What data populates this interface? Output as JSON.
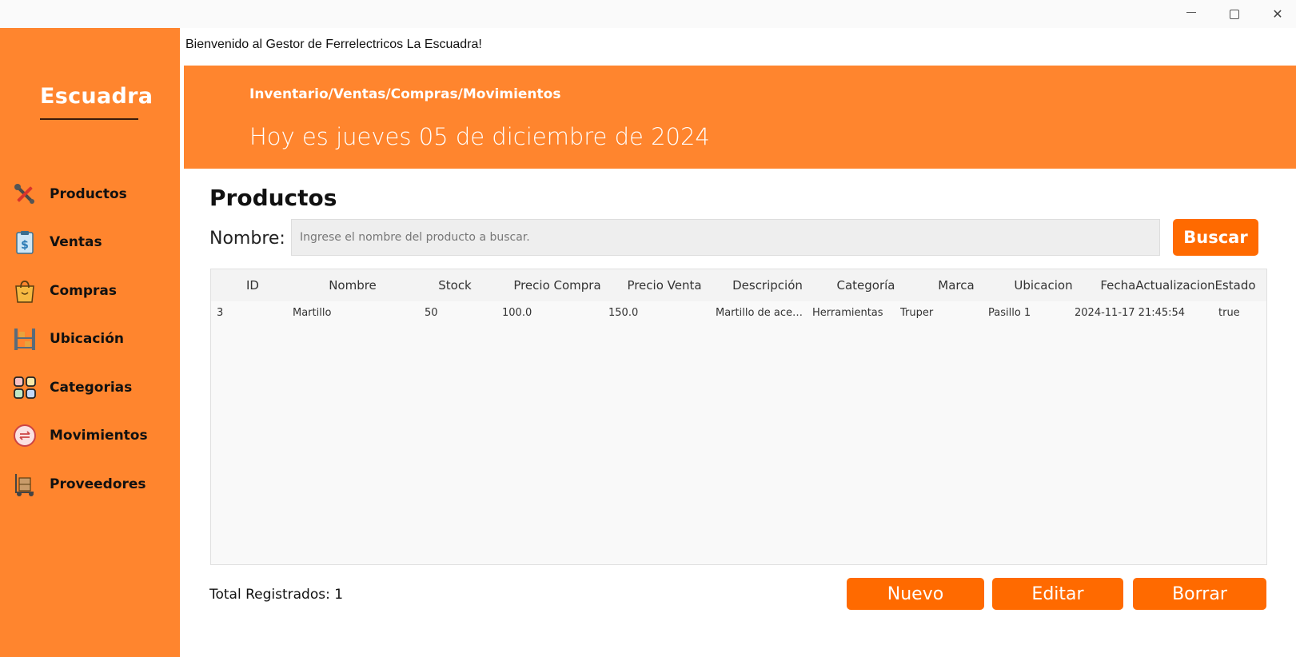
{
  "window": {
    "minimize": "—",
    "close": "✕"
  },
  "sidebar": {
    "brand": "Escuadra",
    "items": [
      {
        "label": "Productos",
        "icon": "tools-icon"
      },
      {
        "label": "Ventas",
        "icon": "clipboard-dollar-icon"
      },
      {
        "label": "Compras",
        "icon": "shopping-bag-icon"
      },
      {
        "label": "Ubicación",
        "icon": "shelf-icon"
      },
      {
        "label": "Categorias",
        "icon": "grid-categories-icon"
      },
      {
        "label": "Movimientos",
        "icon": "clock-exchange-icon"
      },
      {
        "label": "Proveedores",
        "icon": "hand-truck-icon"
      }
    ]
  },
  "welcome": "Bienvenido al Gestor de Ferrelectricos La Escuadra!",
  "header": {
    "breadcrumb": "Inventario/Ventas/Compras/Movimientos",
    "date": "Hoy es jueves 05 de diciembre de 2024"
  },
  "main": {
    "title": "Productos",
    "search": {
      "label": "Nombre:",
      "placeholder": "Ingrese el nombre del producto a buscar.",
      "value": "",
      "button": "Buscar"
    },
    "table": {
      "columns": [
        "ID",
        "Nombre",
        "Stock",
        "Precio Compra",
        "Precio Venta",
        "Descripción",
        "Categoría",
        "Marca",
        "Ubicacion",
        "FechaActualizacion",
        "Estado"
      ],
      "rows": [
        [
          "3",
          "Martillo",
          "50",
          "100.0",
          "150.0",
          "Martillo de acero...",
          "Herramientas",
          "Truper",
          "Pasillo 1",
          "2024-11-17 21:45:54",
          "true"
        ]
      ]
    },
    "total": "Total Registrados: 1",
    "buttons": {
      "nuevo": "Nuevo",
      "editar": "Editar",
      "borrar": "Borrar"
    }
  },
  "colors": {
    "sidebar": "#ff852e",
    "banner": "#ff852e",
    "button": "#ff6a00"
  }
}
